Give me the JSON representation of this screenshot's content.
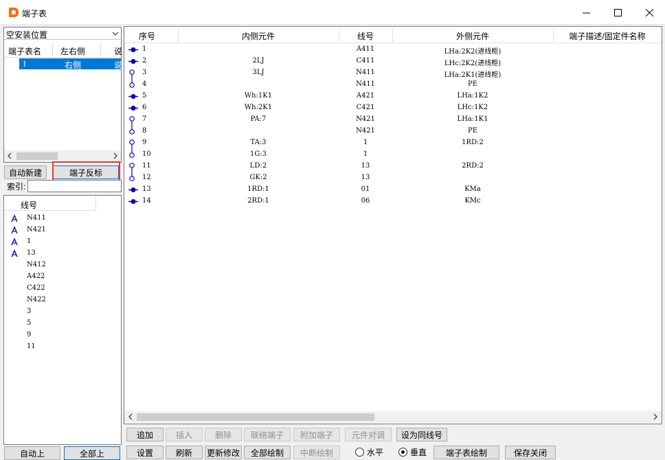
{
  "window": {
    "title": "端子表"
  },
  "location_combo": {
    "value": "空安装位置"
  },
  "terminal_list": {
    "headers": [
      "端子表名",
      "左右侧",
      "说"
    ],
    "selected_row": {
      "name": "I",
      "side": "右侧",
      "desc": "说"
    }
  },
  "left_buttons": {
    "auto_create": "自动新建",
    "reverse_mark": "端子反标"
  },
  "index": {
    "label": "索引:",
    "value": ""
  },
  "wire_list": {
    "header": "线号",
    "rows": [
      {
        "wire": "N411",
        "marked": true
      },
      {
        "wire": "N421",
        "marked": true
      },
      {
        "wire": "1",
        "marked": true
      },
      {
        "wire": "13",
        "marked": true
      },
      {
        "wire": "N412",
        "marked": false
      },
      {
        "wire": "A422",
        "marked": false
      },
      {
        "wire": "C422",
        "marked": false
      },
      {
        "wire": "N422",
        "marked": false
      },
      {
        "wire": "3",
        "marked": false
      },
      {
        "wire": "5",
        "marked": false
      },
      {
        "wire": "9",
        "marked": false
      },
      {
        "wire": "11",
        "marked": false
      }
    ]
  },
  "bottom_left_buttons": {
    "auto_up": "自动上",
    "all_up": "全部上"
  },
  "table": {
    "headers": {
      "no": "序号",
      "inner": "内侧元件",
      "wire": "线号",
      "outer": "外侧元件",
      "desc": "端子描述/固定件名称"
    },
    "rows": [
      {
        "no": "1",
        "type": "solid",
        "inner": "",
        "wire": "A411",
        "outer": "LHa:2K2(进线柜)"
      },
      {
        "no": "2",
        "type": "solid",
        "inner": "2LJ",
        "wire": "C411",
        "outer": "LHc:2K2(进线柜)"
      },
      {
        "no": "3",
        "type": "link-top",
        "inner": "3LJ",
        "wire": "N411",
        "outer": "LHa:2K1(进线柜)"
      },
      {
        "no": "4",
        "type": "link-bottom",
        "inner": "",
        "wire": "N411",
        "outer": "PE"
      },
      {
        "no": "5",
        "type": "solid",
        "inner": "Wh:1K1",
        "wire": "A421",
        "outer": "LHa:1K2"
      },
      {
        "no": "6",
        "type": "solid",
        "inner": "Wh:2K1",
        "wire": "C421",
        "outer": "LHc:1K2"
      },
      {
        "no": "7",
        "type": "link-top",
        "inner": "PA:7",
        "wire": "N421",
        "outer": "LHa:1K1"
      },
      {
        "no": "8",
        "type": "link-bottom",
        "inner": "",
        "wire": "N421",
        "outer": "PE"
      },
      {
        "no": "9",
        "type": "link-top",
        "inner": "TA:3",
        "wire": "1",
        "outer": "1RD:2"
      },
      {
        "no": "10",
        "type": "link-bottom",
        "inner": "1G:3",
        "wire": "1",
        "outer": ""
      },
      {
        "no": "11",
        "type": "link-top",
        "inner": "LD:2",
        "wire": "13",
        "outer": "2RD:2"
      },
      {
        "no": "12",
        "type": "link-bottom",
        "inner": "GK:2",
        "wire": "13",
        "outer": ""
      },
      {
        "no": "13",
        "type": "solid",
        "inner": "1RD:1",
        "wire": "01",
        "outer": "KMa"
      },
      {
        "no": "14",
        "type": "solid",
        "inner": "2RD:1",
        "wire": "06",
        "outer": "KMc"
      }
    ]
  },
  "toolbar_row1": {
    "append": "追加",
    "insert": "插入",
    "delete": "删除",
    "link_terminal": "联络端子",
    "attach_terminal": "附加端子",
    "component_swap": "元件对调",
    "set_same_wire": "设为同线号"
  },
  "toolbar_row2": {
    "settings": "设置",
    "refresh": "刷新",
    "update_changes": "更新修改",
    "draw_all": "全部绘制",
    "draw_break": "中断绘制",
    "horizontal": "水平",
    "vertical": "垂直",
    "draw_table": "端子表绘制",
    "save_close": "保存关闭"
  },
  "colors": {
    "accent": "#0078d7",
    "glyph": "#0000cc",
    "highlight": "#e53935"
  }
}
